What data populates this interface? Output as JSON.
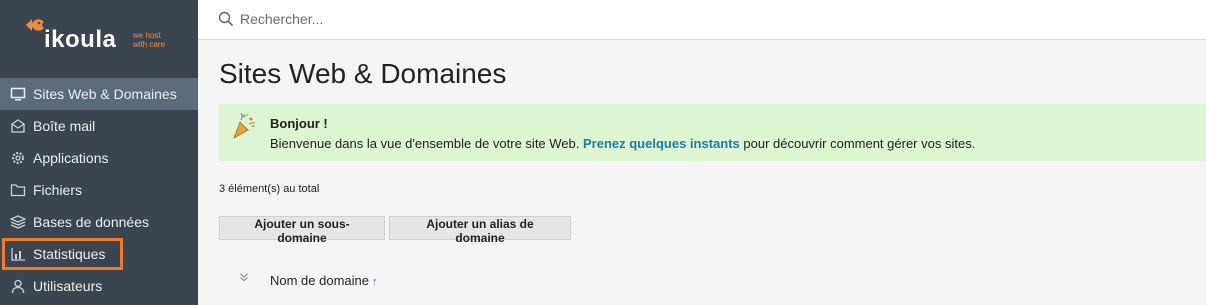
{
  "brand": {
    "name": "ikoula",
    "tagline": "we host with care"
  },
  "sidebar": {
    "items": [
      {
        "label": "Sites Web & Domaines",
        "icon": "monitor-icon",
        "active": true
      },
      {
        "label": "Boîte mail",
        "icon": "mail-icon"
      },
      {
        "label": "Applications",
        "icon": "gear-icon"
      },
      {
        "label": "Fichiers",
        "icon": "folder-icon"
      },
      {
        "label": "Bases de données",
        "icon": "database-icon"
      },
      {
        "label": "Statistiques",
        "icon": "bar-chart-icon",
        "highlighted": true
      },
      {
        "label": "Utilisateurs",
        "icon": "user-icon"
      }
    ]
  },
  "search": {
    "placeholder": "Rechercher..."
  },
  "main": {
    "title": "Sites Web & Domaines",
    "banner": {
      "title": "Bonjour !",
      "text_before": "Bienvenue dans la vue d'ensemble de votre site Web. ",
      "link": "Prenez quelques instants",
      "text_after": " pour découvrir comment gérer vos sites."
    },
    "count": "3 élément(s) au total",
    "buttons": {
      "add_subdomain": "Ajouter un sous-domaine",
      "add_alias": "Ajouter un alias de domaine"
    },
    "table": {
      "column_domain": "Nom de domaine",
      "sort_indicator": "↑"
    }
  },
  "colors": {
    "sidebar_bg": "#3a4550",
    "sidebar_active": "#5c6b78",
    "highlight": "#f07a20",
    "banner_bg": "#def5d2",
    "link": "#1a7fa8",
    "brand_orange": "#f08c3a"
  }
}
